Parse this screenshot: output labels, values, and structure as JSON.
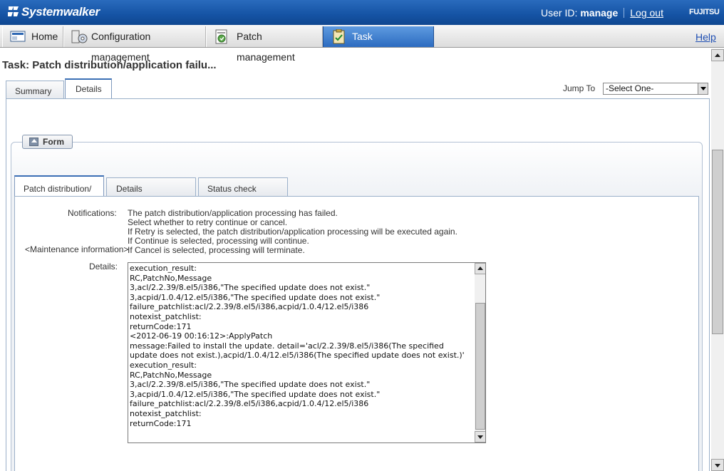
{
  "header": {
    "app_name": "Systemwalker",
    "user_id_label": "User ID:",
    "user_id": "manage",
    "logout_label": "Log out",
    "brand": "FUJITSU"
  },
  "menu": {
    "items": [
      {
        "label": "Home",
        "icon": "home-icon"
      },
      {
        "label": "Configuration management",
        "icon": "configuration-icon"
      },
      {
        "label": "Patch management",
        "icon": "patch-icon"
      },
      {
        "label": "Task management",
        "icon": "task-clipboard-icon",
        "active": true
      }
    ],
    "help_label": "Help"
  },
  "page": {
    "title": "Task: Patch distribution/application failu...",
    "tabs": [
      {
        "label": "Summary"
      },
      {
        "label": "Details",
        "active": true
      }
    ],
    "jump_to_label": "Jump To",
    "jump_to_value": "-Select One-"
  },
  "form": {
    "legend": "Form",
    "tabs": [
      {
        "label": "Patch distribution/",
        "active": true
      },
      {
        "label": "Details"
      },
      {
        "label": "Status check"
      }
    ],
    "notifications_label": "Notifications:",
    "notification_lines": [
      "The patch distribution/application processing has failed.",
      "Select whether to retry continue or cancel.",
      "If Retry is selected, the patch distribution/application processing will be executed again.",
      "If Continue is selected, processing will continue.",
      "If Cancel is selected, processing will terminate."
    ],
    "maintenance_label": "<Maintenance information>",
    "details_label": "Details:",
    "details_text": "execution_result:\nRC,PatchNo,Message\n3,acl/2.2.39/8.el5/i386,\"The specified update does not exist.\"\n3,acpid/1.0.4/12.el5/i386,\"The specified update does not exist.\"\nfailure_patchlist:acl/2.2.39/8.el5/i386,acpid/1.0.4/12.el5/i386\nnotexist_patchlist:\nreturnCode:171\n<2012-06-19 00:16:12>:ApplyPatch\nmessage:Failed to install the update. detail='acl/2.2.39/8.el5/i386(The specified update does not exist.),acpid/1.0.4/12.el5/i386(The specified update does not exist.)'\nexecution_result:\nRC,PatchNo,Message\n3,acl/2.2.39/8.el5/i386,\"The specified update does not exist.\"\n3,acpid/1.0.4/12.el5/i386,\"The specified update does not exist.\"\nfailure_patchlist:acl/2.2.39/8.el5/i386,acpid/1.0.4/12.el5/i386\nnotexist_patchlist:\nreturnCode:171"
  },
  "colors": {
    "header_blue": "#1553a4",
    "active_menu": "#2c6bc0",
    "link_blue": "#1f4fb3"
  }
}
